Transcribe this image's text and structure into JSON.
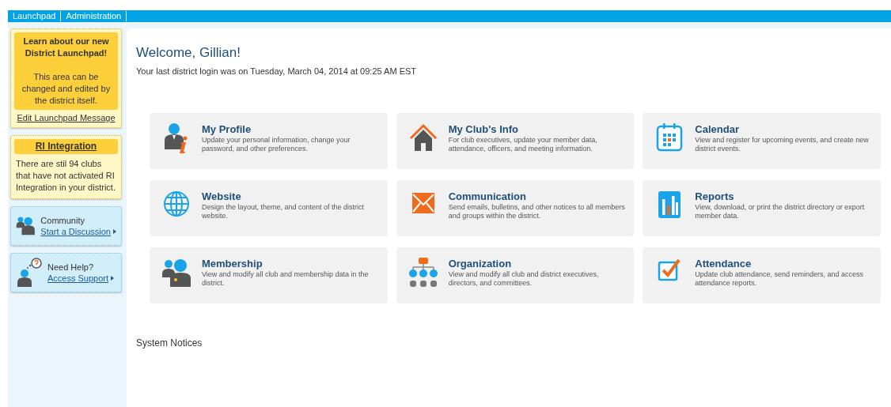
{
  "top_nav": {
    "items": [
      {
        "label": "Launchpad"
      },
      {
        "label": "Administration"
      }
    ]
  },
  "sidebar": {
    "message": {
      "title": "Learn about our new District Launchpad!",
      "body": "This area can be changed and edited by the district itself.",
      "link": "Edit Launchpad Message"
    },
    "integration": {
      "title": "RI Integration",
      "body": "There are stil 94 clubs that have not activated RI Integration in your district."
    },
    "shortcuts": [
      {
        "kind": "community",
        "label": "Community",
        "link": "Start a Discussion"
      },
      {
        "kind": "help",
        "label": "Need Help?",
        "link": "Access Support"
      }
    ]
  },
  "main": {
    "welcome": "Welcome, Gillian!",
    "last_login": "Your last district login was on Tuesday, March 04, 2014 at 09:25 AM EST",
    "tiles": [
      {
        "kind": "profile",
        "title": "My Profile",
        "description": "Update your personal information, change your password, and other preferences."
      },
      {
        "kind": "club",
        "title": "My Club's Info",
        "description": "For club executives, update your member data, attendance, officers, and meeting information."
      },
      {
        "kind": "calendar",
        "title": "Calendar",
        "description": "View and register for upcoming events, and create new district events."
      },
      {
        "kind": "website",
        "title": "Website",
        "description": "Design the layout, theme, and content of the district website."
      },
      {
        "kind": "communication",
        "title": "Communication",
        "description": "Send emails, bulletins, and other notices to all members and groups within the district."
      },
      {
        "kind": "reports",
        "title": "Reports",
        "description": "View, download, or print the district directory or export member data."
      },
      {
        "kind": "membership",
        "title": "Membership",
        "description": "View and modify all club and membership data in the district."
      },
      {
        "kind": "organization",
        "title": "Organization",
        "description": "View and modify all club and district executives, directors, and committees."
      },
      {
        "kind": "attendance",
        "title": "Attendance",
        "description": "Update club attendance, send reminders, and access attendance reports."
      }
    ],
    "notices_title": "System Notices"
  }
}
